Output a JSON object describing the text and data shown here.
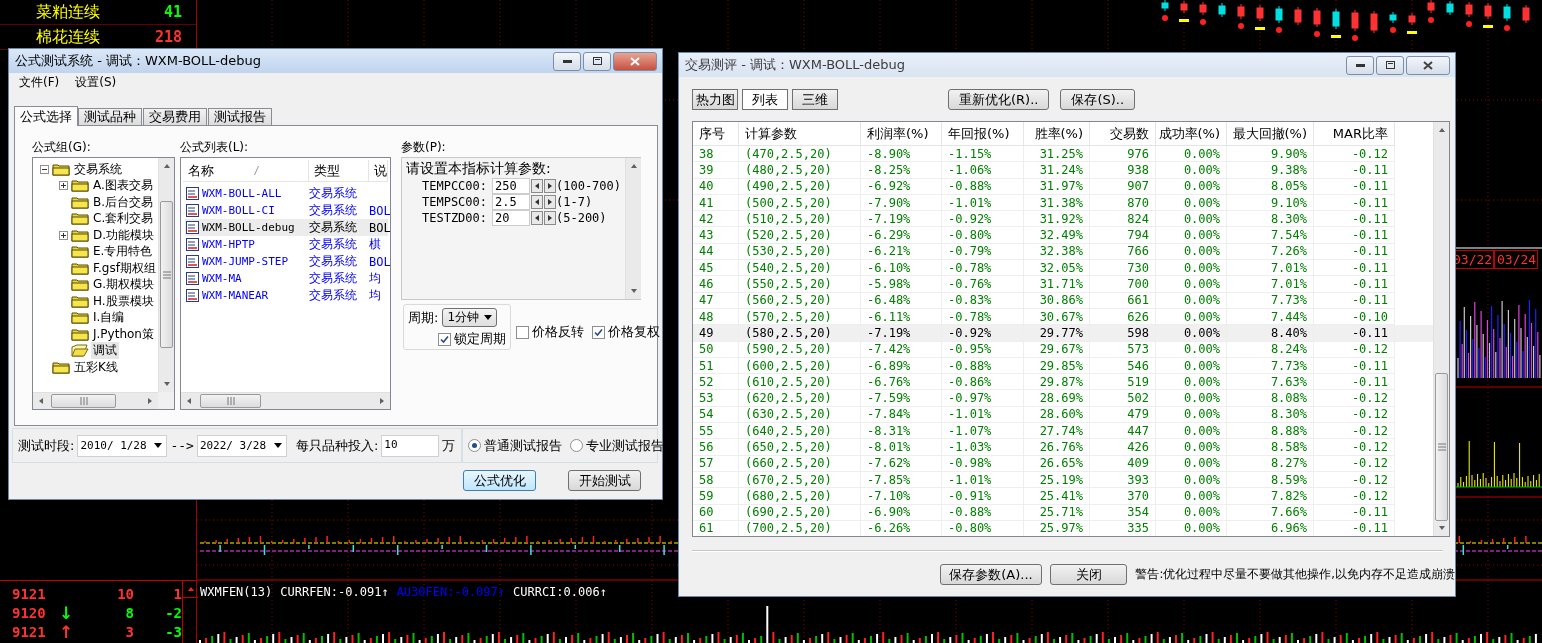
{
  "background": {
    "quotes": [
      {
        "name": "菜粕连续",
        "value": "41",
        "color": "#00ff00"
      },
      {
        "name": "棉花连续",
        "value": "218",
        "color": "#ff3232"
      }
    ],
    "ticks": [
      {
        "price": "9121",
        "volume": {
          "text": "10",
          "color": "#ff3232"
        },
        "change": {
          "text": "1",
          "color": "#ff3232"
        }
      },
      {
        "price": "9120",
        "arrow": {
          "text": "↓",
          "color": "#00ff00"
        },
        "volume": {
          "text": "8",
          "color": "#00ff00"
        },
        "change": {
          "text": "-2",
          "color": "#00ff00"
        }
      },
      {
        "price": "9121",
        "arrow": {
          "text": "↑",
          "color": "#ff3232"
        },
        "volume": {
          "text": "3",
          "color": "#ff3232"
        },
        "change": {
          "text": "-3",
          "color": "#00ff00"
        }
      }
    ],
    "indicator": [
      {
        "text": "WXMFEN(13)",
        "color": "#ffffff"
      },
      {
        "text": "CURRFEN:-0.091↑",
        "color": "#ffffff"
      },
      {
        "text": "AU30FEN:-0.097↑",
        "color": "#0000ff"
      },
      {
        "text": "CURRCI:0.006↑",
        "color": "#ffffff"
      }
    ],
    "dates": [
      "03/22",
      "03/24"
    ]
  },
  "formula_window": {
    "title": "公式测试系统 - 调试：WXM-BOLL-debug",
    "active": true,
    "menu": [
      "文件(F)",
      "设置(S)"
    ],
    "tabs": [
      {
        "label": "公式选择",
        "selected": true
      },
      {
        "label": "测试品种",
        "selected": false
      },
      {
        "label": "交易费用",
        "selected": false
      },
      {
        "label": "测试报告",
        "selected": false
      }
    ],
    "group_label": "公式组(G):",
    "tree": [
      {
        "label": "交易系统",
        "expanded": true,
        "selected": false,
        "children": [
          {
            "label": "A.图表交易",
            "expanded": false,
            "selected": false
          },
          {
            "label": "B.后台交易",
            "selected": false
          },
          {
            "label": "C.套利交易",
            "selected": false
          },
          {
            "label": "D.功能模块",
            "expanded": false,
            "selected": false
          },
          {
            "label": "E.专用特色",
            "selected": false
          },
          {
            "label": "F.gsf期权组",
            "selected": false
          },
          {
            "label": "G.期权模块",
            "selected": false
          },
          {
            "label": "H.股票模块",
            "selected": false
          },
          {
            "label": "I.自编",
            "selected": false
          },
          {
            "label": "J.Python策",
            "selected": false
          },
          {
            "label": "调试",
            "selected": true
          }
        ]
      },
      {
        "label": "五彩K线",
        "selected": false
      }
    ],
    "list_label": "公式列表(L):",
    "list_columns": [
      "名称",
      "类型",
      "说"
    ],
    "formulas": [
      {
        "name": "WXM-BOLL-ALL",
        "type": "交易系统",
        "selected": false
      },
      {
        "name": "WXM-BOLL-CI",
        "type": "交易系统",
        "note": "BOL",
        "selected": false
      },
      {
        "name": "WXM-BOLL-debug",
        "type": "交易系统",
        "note": "BOL",
        "selected": true
      },
      {
        "name": "WXM-HPTP",
        "type": "交易系统",
        "note": "棋",
        "selected": false
      },
      {
        "name": "WXM-JUMP-STEP",
        "type": "交易系统",
        "note": "BOL",
        "selected": false
      },
      {
        "name": "WXM-MA",
        "type": "交易系统",
        "note": "均",
        "selected": false
      },
      {
        "name": "WXM-MANEAR",
        "type": "交易系统",
        "note": "均",
        "selected": false
      }
    ],
    "params_label": "参数(P):",
    "params_title": "请设置本指标计算参数:",
    "params": [
      {
        "name": "TEMPCC00:",
        "value": "250",
        "range": "(100-700)"
      },
      {
        "name": "TEMPSC00:",
        "value": "2.5",
        "range": "(1-7)"
      },
      {
        "name": "TESTZD00:",
        "value": "20",
        "range": "(5-200)"
      }
    ],
    "period_label": "周期:",
    "period": "1分钟",
    "lock_period": {
      "label": "锁定周期",
      "checked": true
    },
    "options": [
      {
        "label": "价格反转",
        "checked": false
      },
      {
        "label": "价格复权",
        "checked": true
      }
    ],
    "range_label": "测试时段:",
    "start_date": "2010/ 1/28",
    "range_arrow": "-->",
    "end_date": "2022/ 3/28",
    "invest_label": "每只品种投入:",
    "invest": "10",
    "invest_unit": "万",
    "reports": [
      {
        "label": "普通测试报告",
        "selected": true
      },
      {
        "label": "专业测试报告",
        "selected": false
      }
    ],
    "buttons": [
      {
        "label": "公式优化",
        "default": true
      },
      {
        "label": "开始测试",
        "default": false
      }
    ]
  },
  "report_window": {
    "title": "交易测评 - 调试：WXM-BOLL-debug",
    "active": false,
    "views": [
      {
        "label": "热力图",
        "selected": false
      },
      {
        "label": "列表",
        "selected": true
      },
      {
        "label": "三维",
        "selected": false
      }
    ],
    "actions": [
      "重新优化(R)..",
      "保存(S).."
    ],
    "columns": [
      "序号",
      "计算参数",
      "利润率(%)",
      "年回报(%)",
      "胜率(%)",
      "交易数",
      "成功率(%)",
      "最大回撤(%)",
      "MAR比率"
    ],
    "rows": [
      {
        "cells": [
          "38",
          "(470,2.5,20)",
          "-8.90%",
          "-1.15%",
          "31.25%",
          "976",
          "0.00%",
          "9.90%",
          "-0.12"
        ],
        "selected": false
      },
      {
        "cells": [
          "39",
          "(480,2.5,20)",
          "-8.25%",
          "-1.06%",
          "31.24%",
          "938",
          "0.00%",
          "9.38%",
          "-0.11"
        ],
        "selected": false
      },
      {
        "cells": [
          "40",
          "(490,2.5,20)",
          "-6.92%",
          "-0.88%",
          "31.97%",
          "907",
          "0.00%",
          "8.05%",
          "-0.11"
        ],
        "selected": false
      },
      {
        "cells": [
          "41",
          "(500,2.5,20)",
          "-7.90%",
          "-1.01%",
          "31.38%",
          "870",
          "0.00%",
          "9.10%",
          "-0.11"
        ],
        "selected": false
      },
      {
        "cells": [
          "42",
          "(510,2.5,20)",
          "-7.19%",
          "-0.92%",
          "31.92%",
          "824",
          "0.00%",
          "8.30%",
          "-0.11"
        ],
        "selected": false
      },
      {
        "cells": [
          "43",
          "(520,2.5,20)",
          "-6.29%",
          "-0.80%",
          "32.49%",
          "794",
          "0.00%",
          "7.54%",
          "-0.11"
        ],
        "selected": false
      },
      {
        "cells": [
          "44",
          "(530,2.5,20)",
          "-6.21%",
          "-0.79%",
          "32.38%",
          "766",
          "0.00%",
          "7.26%",
          "-0.11"
        ],
        "selected": false
      },
      {
        "cells": [
          "45",
          "(540,2.5,20)",
          "-6.10%",
          "-0.78%",
          "32.05%",
          "730",
          "0.00%",
          "7.01%",
          "-0.11"
        ],
        "selected": false
      },
      {
        "cells": [
          "46",
          "(550,2.5,20)",
          "-5.98%",
          "-0.76%",
          "31.71%",
          "700",
          "0.00%",
          "7.01%",
          "-0.11"
        ],
        "selected": false
      },
      {
        "cells": [
          "47",
          "(560,2.5,20)",
          "-6.48%",
          "-0.83%",
          "30.86%",
          "661",
          "0.00%",
          "7.73%",
          "-0.11"
        ],
        "selected": false
      },
      {
        "cells": [
          "48",
          "(570,2.5,20)",
          "-6.11%",
          "-0.78%",
          "30.67%",
          "626",
          "0.00%",
          "7.44%",
          "-0.10"
        ],
        "selected": false
      },
      {
        "cells": [
          "49",
          "(580,2.5,20)",
          "-7.19%",
          "-0.92%",
          "29.77%",
          "598",
          "0.00%",
          "8.40%",
          "-0.11"
        ],
        "selected": true
      },
      {
        "cells": [
          "50",
          "(590,2.5,20)",
          "-7.42%",
          "-0.95%",
          "29.67%",
          "573",
          "0.00%",
          "8.24%",
          "-0.12"
        ],
        "selected": false
      },
      {
        "cells": [
          "51",
          "(600,2.5,20)",
          "-6.89%",
          "-0.88%",
          "29.85%",
          "546",
          "0.00%",
          "7.73%",
          "-0.11"
        ],
        "selected": false
      },
      {
        "cells": [
          "52",
          "(610,2.5,20)",
          "-6.76%",
          "-0.86%",
          "29.87%",
          "519",
          "0.00%",
          "7.63%",
          "-0.11"
        ],
        "selected": false
      },
      {
        "cells": [
          "53",
          "(620,2.5,20)",
          "-7.59%",
          "-0.97%",
          "28.69%",
          "502",
          "0.00%",
          "8.08%",
          "-0.12"
        ],
        "selected": false
      },
      {
        "cells": [
          "54",
          "(630,2.5,20)",
          "-7.84%",
          "-1.01%",
          "28.60%",
          "479",
          "0.00%",
          "8.30%",
          "-0.12"
        ],
        "selected": false
      },
      {
        "cells": [
          "55",
          "(640,2.5,20)",
          "-8.31%",
          "-1.07%",
          "27.74%",
          "447",
          "0.00%",
          "8.88%",
          "-0.12"
        ],
        "selected": false
      },
      {
        "cells": [
          "56",
          "(650,2.5,20)",
          "-8.01%",
          "-1.03%",
          "26.76%",
          "426",
          "0.00%",
          "8.58%",
          "-0.12"
        ],
        "selected": false
      },
      {
        "cells": [
          "57",
          "(660,2.5,20)",
          "-7.62%",
          "-0.98%",
          "26.65%",
          "409",
          "0.00%",
          "8.27%",
          "-0.12"
        ],
        "selected": false
      },
      {
        "cells": [
          "58",
          "(670,2.5,20)",
          "-7.85%",
          "-1.01%",
          "25.19%",
          "393",
          "0.00%",
          "8.59%",
          "-0.12"
        ],
        "selected": false
      },
      {
        "cells": [
          "59",
          "(680,2.5,20)",
          "-7.10%",
          "-0.91%",
          "25.41%",
          "370",
          "0.00%",
          "7.82%",
          "-0.12"
        ],
        "selected": false
      },
      {
        "cells": [
          "60",
          "(690,2.5,20)",
          "-6.90%",
          "-0.88%",
          "25.71%",
          "354",
          "0.00%",
          "7.66%",
          "-0.11"
        ],
        "selected": false
      },
      {
        "cells": [
          "61",
          "(700,2.5,20)",
          "-6.26%",
          "-0.80%",
          "25.97%",
          "335",
          "0.00%",
          "6.96%",
          "-0.11"
        ],
        "selected": false
      }
    ],
    "footer_buttons": [
      "保存参数(A)...",
      "关闭"
    ],
    "warning": "警告:优化过程中尽量不要做其他操作,以免内存不足造成崩溃"
  }
}
